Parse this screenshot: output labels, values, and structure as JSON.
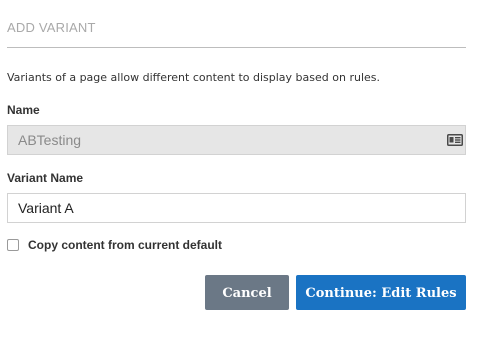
{
  "dialog": {
    "title": "ADD VARIANT",
    "description": "Variants of a page allow different content to display based on rules.",
    "name_label": "Name",
    "name_value": "ABTesting",
    "variant_name_label": "Variant Name",
    "variant_name_value": "Variant A",
    "copy_content_label": "Copy content from current default",
    "copy_content_checked": false,
    "cancel_label": "Cancel",
    "continue_label": "Continue: Edit Rules"
  },
  "icons": {
    "name_field_icon": "contact-card-icon"
  },
  "colors": {
    "cancel_button": "#6b7886",
    "continue_button": "#1a73c3",
    "readonly_field_bg": "#e6e6e6"
  }
}
